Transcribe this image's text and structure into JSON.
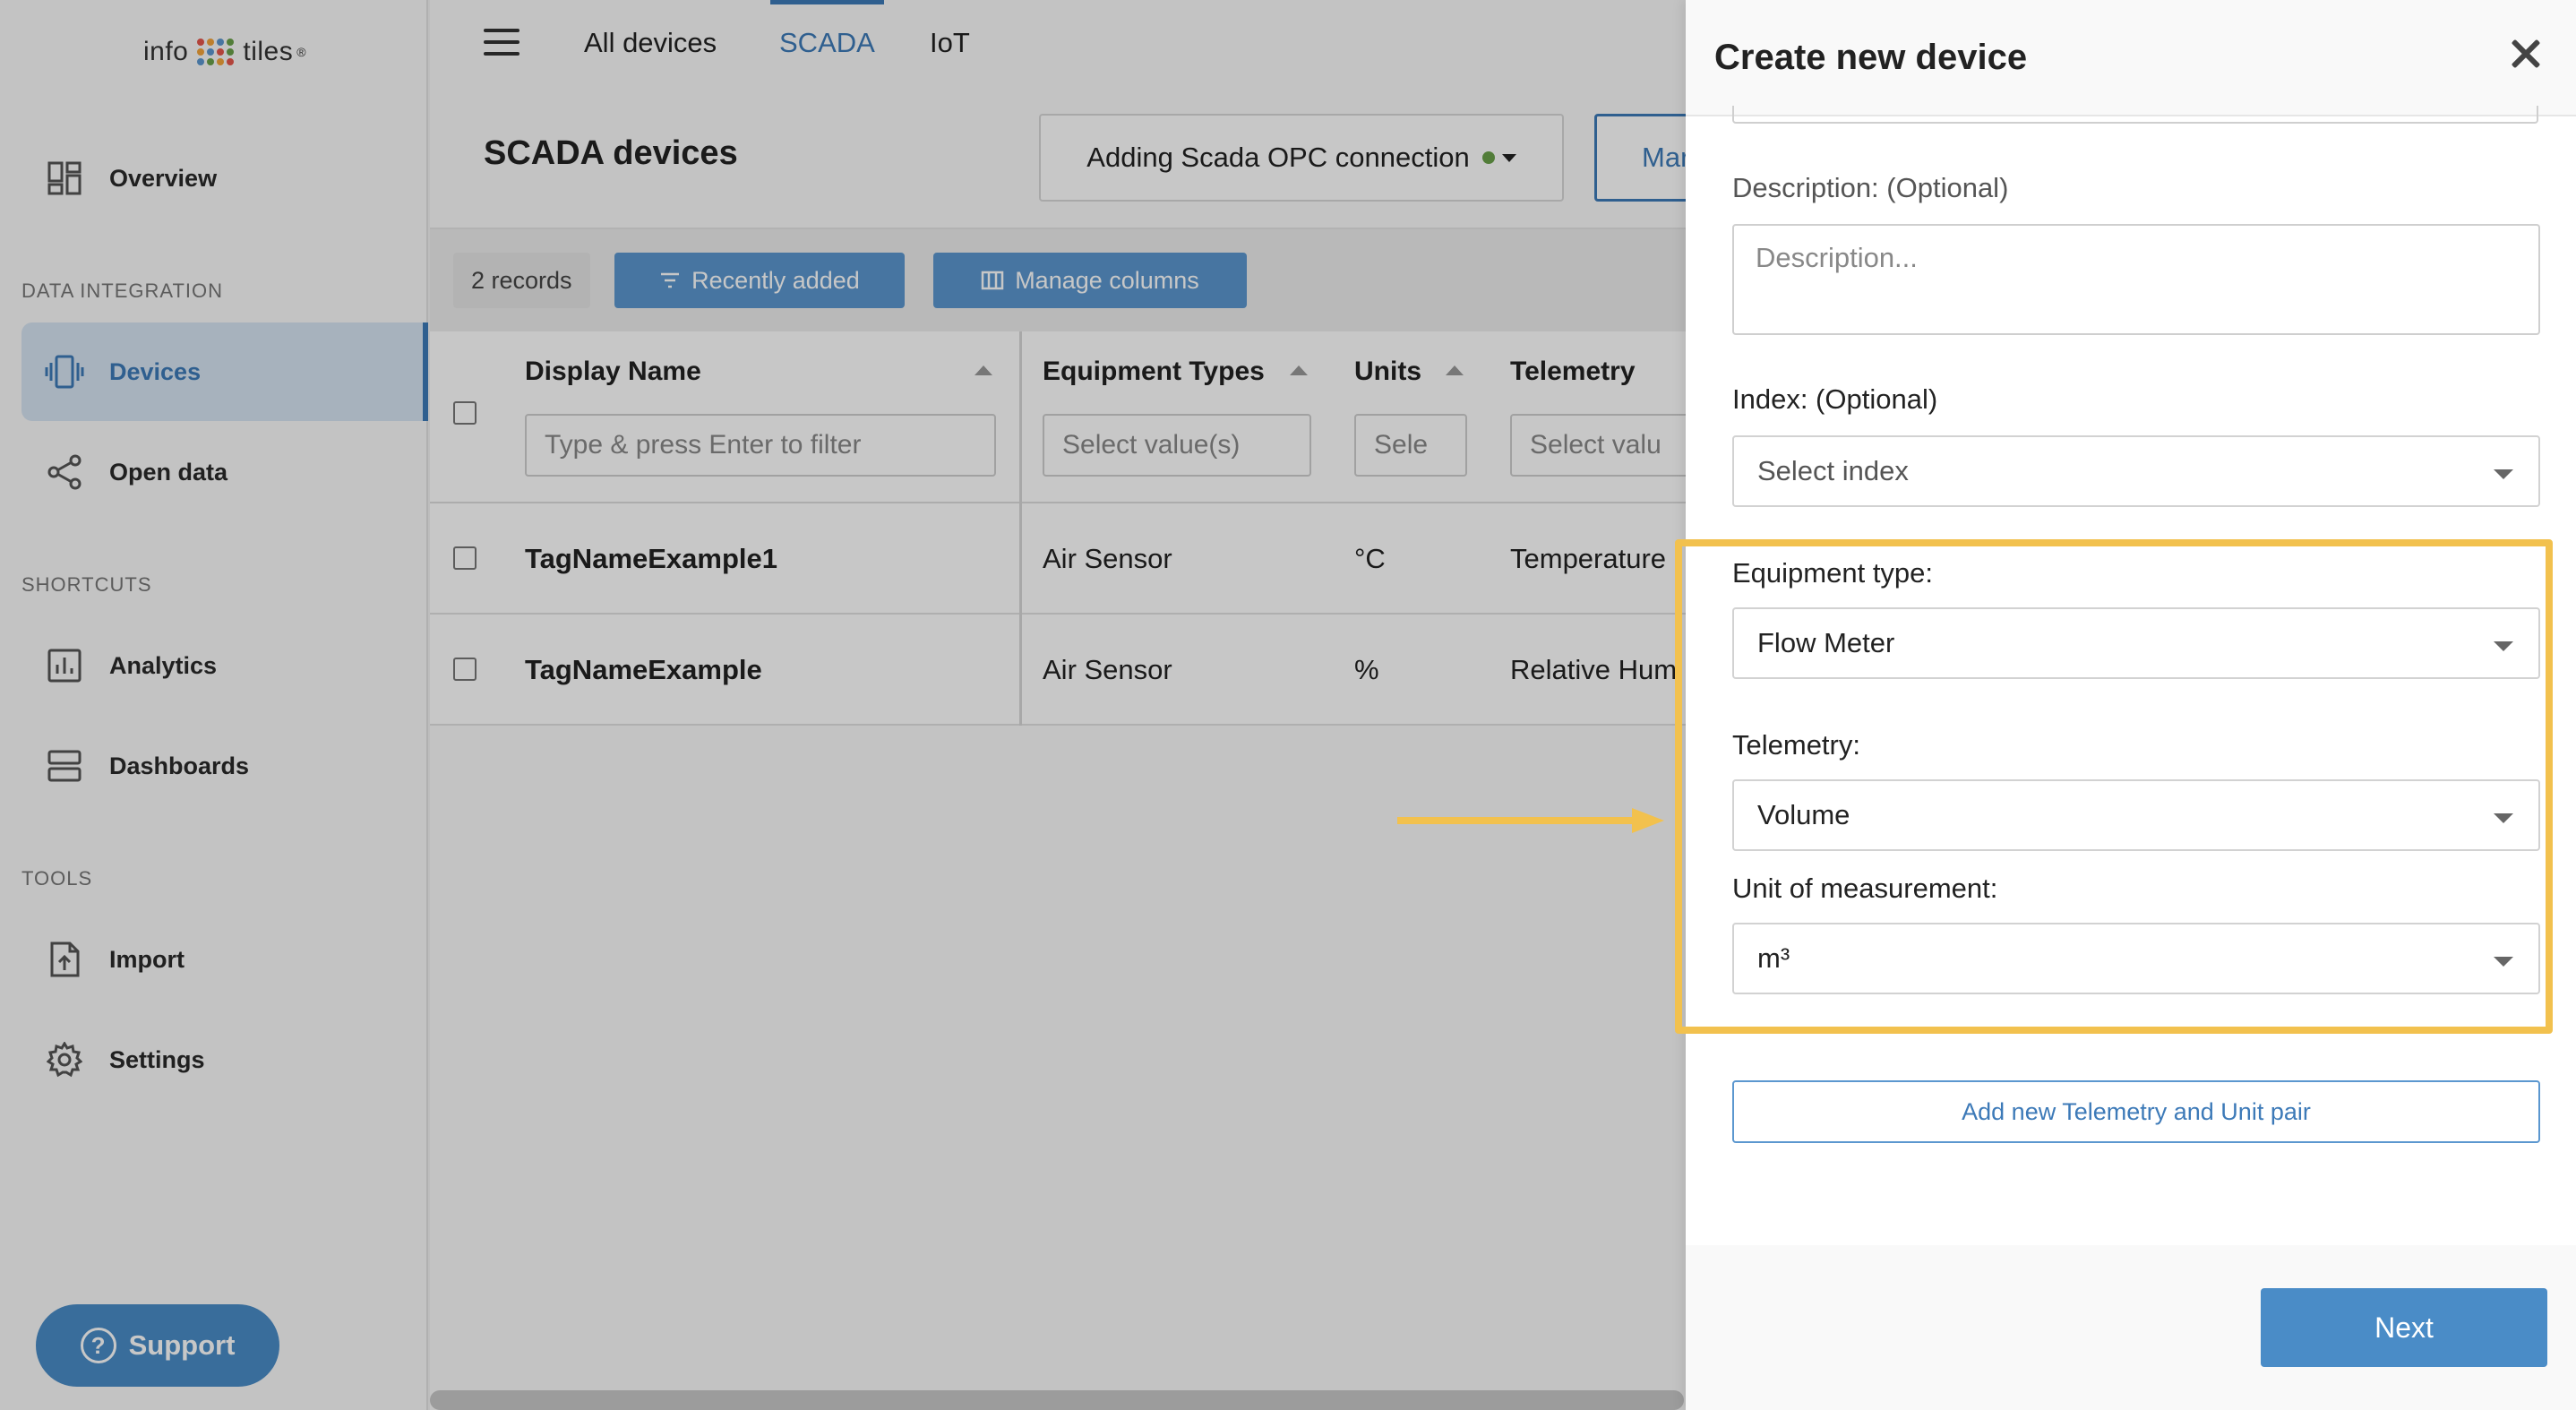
{
  "sidebar": {
    "logo": {
      "left": "info",
      "right": "tiles",
      "mark": "®",
      "dot_colors": [
        "#e4574b",
        "#f2a33a",
        "#5b97cf",
        "#6aa14a",
        "#f2a33a",
        "#5b97cf",
        "#e4574b",
        "#6aa14a",
        "#5b97cf",
        "#6aa14a",
        "#f2a33a",
        "#e4574b"
      ]
    },
    "overview": "Overview",
    "sections": {
      "data_integration": "DATA INTEGRATION",
      "shortcuts": "SHORTCUTS",
      "tools": "TOOLS"
    },
    "devices": "Devices",
    "open_data": "Open data",
    "analytics": "Analytics",
    "dashboards": "Dashboards",
    "import": "Import",
    "settings": "Settings",
    "support": "Support",
    "accent": "#3d7ab8"
  },
  "topbar": {
    "tabs": [
      "All devices",
      "SCADA",
      "IoT"
    ],
    "active_tab": "SCADA"
  },
  "page": {
    "title": "SCADA devices",
    "connection_button": "Adding Scada OPC connection",
    "manage_button": "Mar"
  },
  "toolbar": {
    "records": "2 records",
    "recently_added": "Recently added",
    "manage_columns": "Manage columns"
  },
  "table": {
    "columns": {
      "display_name": "Display Name",
      "equipment_types": "Equipment Types",
      "units": "Units",
      "telemetry": "Telemetry"
    },
    "filters": {
      "display_name": "Type & press Enter to filter",
      "equipment_types": "Select value(s)",
      "units": "Sele",
      "telemetry": "Select valu"
    },
    "rows": [
      {
        "name": "TagNameExample1",
        "equipment": "Air Sensor",
        "unit": "°C",
        "telemetry": "Temperature"
      },
      {
        "name": "TagNameExample",
        "equipment": "Air Sensor",
        "unit": "%",
        "telemetry": "Relative Hum"
      }
    ]
  },
  "drawer": {
    "title": "Create new device",
    "description_label": "Description: (Optional)",
    "description_placeholder": "Description...",
    "index_label": "Index: (Optional)",
    "index_value": "Select index",
    "equipment_label": "Equipment type:",
    "equipment_value": "Flow Meter",
    "telemetry_label": "Telemetry:",
    "telemetry_value": "Volume",
    "unit_label": "Unit of measurement:",
    "unit_value": "m³",
    "add_pair": "Add new Telemetry and Unit pair",
    "next": "Next",
    "highlight_color": "#f2c14e"
  }
}
